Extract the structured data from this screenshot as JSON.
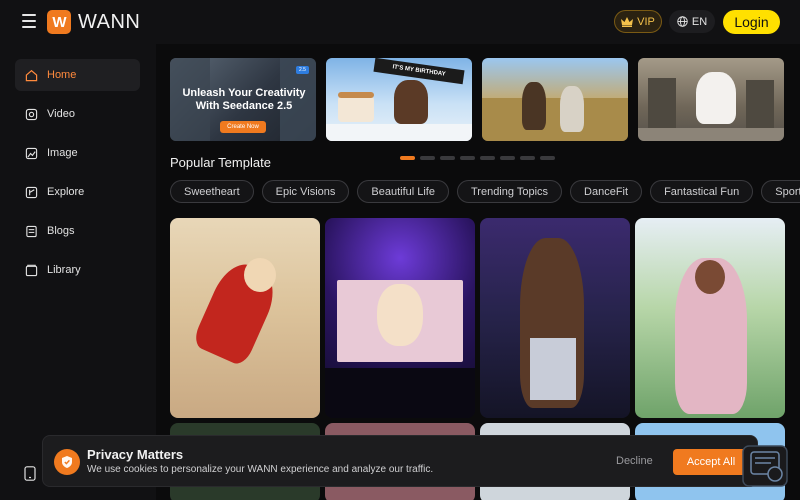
{
  "app": {
    "logo_letter": "W",
    "name": "WANN"
  },
  "header": {
    "vip_label": "VIP",
    "lang_label": "EN",
    "login_label": "Login"
  },
  "sidebar": {
    "items": [
      {
        "label": "Home",
        "icon": "home-icon",
        "active": true
      },
      {
        "label": "Video",
        "icon": "video-icon"
      },
      {
        "label": "Image",
        "icon": "image-icon"
      },
      {
        "label": "Explore",
        "icon": "explore-icon"
      },
      {
        "label": "Blogs",
        "icon": "blogs-icon"
      },
      {
        "label": "Library",
        "icon": "library-icon"
      }
    ]
  },
  "banners": {
    "first_title": "Unleash Your Creativity With Seedance 2.5",
    "first_cta": "Create Now",
    "first_tag": "2.5",
    "second_sign": "IT'S MY BIRTHDAY"
  },
  "section": {
    "title": "Popular Template",
    "carousel_dots": 8,
    "active_dot": 0
  },
  "chips": [
    "Sweetheart",
    "Epic Visions",
    "Beautiful Life",
    "Trending Topics",
    "DanceFit",
    "Fantastical Fun",
    "Sports Li"
  ],
  "cookie": {
    "title": "Privacy Matters",
    "text": "We use cookies to personalize your WANN experience and analyze our traffic.",
    "decline_label": "Decline",
    "accept_label": "Accept All"
  },
  "colors": {
    "accent": "#f07a1f",
    "login": "#ffe000",
    "vip": "#f3c14b"
  }
}
